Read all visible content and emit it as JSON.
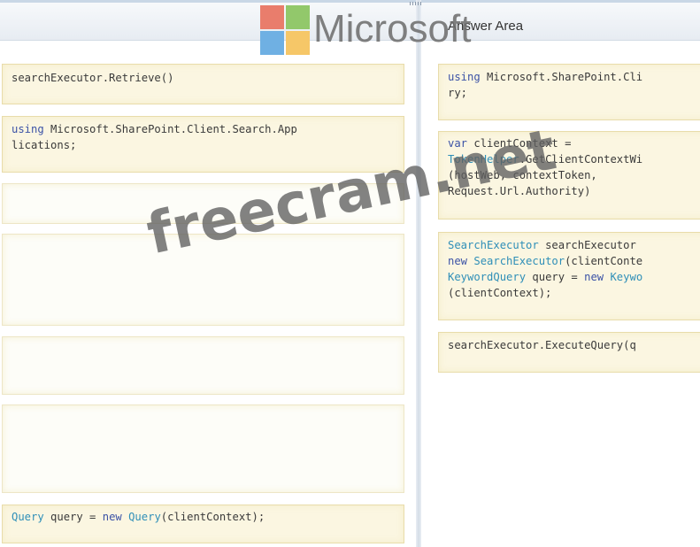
{
  "left_pane": {
    "source_tiles": [
      {
        "lines": [
          [
            {
              "t": "searchExecutor.Retrieve()",
              "c": "plain"
            }
          ]
        ]
      },
      {
        "lines": [
          [
            {
              "t": "using",
              "c": "kw"
            },
            {
              "t": " Microsoft.SharePoint.Client.Search.App",
              "c": "plain"
            }
          ],
          [
            {
              "t": "lications;",
              "c": "plain"
            }
          ]
        ]
      },
      {
        "lines": []
      },
      {
        "lines": []
      },
      {
        "lines": []
      },
      {
        "lines": []
      },
      {
        "lines": [
          [
            {
              "t": "Query",
              "c": "ty"
            },
            {
              "t": " query = ",
              "c": "plain"
            },
            {
              "t": "new",
              "c": "kw"
            },
            {
              "t": " ",
              "c": "plain"
            },
            {
              "t": "Query",
              "c": "ty"
            },
            {
              "t": "(clientContext);",
              "c": "plain"
            }
          ]
        ]
      }
    ]
  },
  "right_pane": {
    "title": "Answer Area",
    "answer_tiles": [
      {
        "lines": [
          [
            {
              "t": "using",
              "c": "kw"
            },
            {
              "t": " Microsoft.SharePoint.Cli",
              "c": "plain"
            }
          ],
          [
            {
              "t": "ry;",
              "c": "plain"
            }
          ]
        ]
      },
      {
        "lines": [
          [
            {
              "t": "var",
              "c": "kw"
            },
            {
              "t": " clientContext =",
              "c": "plain"
            }
          ],
          [
            {
              "t": "TokenHelper",
              "c": "ty"
            },
            {
              "t": ".GetClientContextWi",
              "c": "plain"
            }
          ],
          [
            {
              "t": "(hostWeb, contextToken,",
              "c": "plain"
            }
          ],
          [
            {
              "t": "Request.Url.Authority)",
              "c": "plain"
            }
          ]
        ]
      },
      {
        "lines": [
          [
            {
              "t": "SearchExecutor",
              "c": "ty"
            },
            {
              "t": " searchExecutor",
              "c": "plain"
            }
          ],
          [
            {
              "t": "new",
              "c": "kw"
            },
            {
              "t": " ",
              "c": "plain"
            },
            {
              "t": "SearchExecutor",
              "c": "ty"
            },
            {
              "t": "(clientConte",
              "c": "plain"
            }
          ],
          [
            {
              "t": "KeywordQuery",
              "c": "ty"
            },
            {
              "t": " query = ",
              "c": "plain"
            },
            {
              "t": "new",
              "c": "kw"
            },
            {
              "t": " ",
              "c": "plain"
            },
            {
              "t": "Keywo",
              "c": "ty"
            }
          ],
          [
            {
              "t": "(clientContext);",
              "c": "plain"
            }
          ]
        ]
      },
      {
        "lines": [
          [
            {
              "t": "searchExecutor.ExecuteQuery(q",
              "c": "plain"
            }
          ]
        ]
      }
    ]
  },
  "logo": {
    "text": "Microsoft",
    "colors": [
      "#e97d6c",
      "#92c86b",
      "#6fb0e3",
      "#f6c768"
    ]
  },
  "watermark": {
    "text": "freecram.net"
  },
  "colors": {
    "keyword": "#3b52a6",
    "type": "#2f8fb8",
    "tile_bg": "#fbf6e1",
    "tile_border": "#e8dcaa"
  }
}
